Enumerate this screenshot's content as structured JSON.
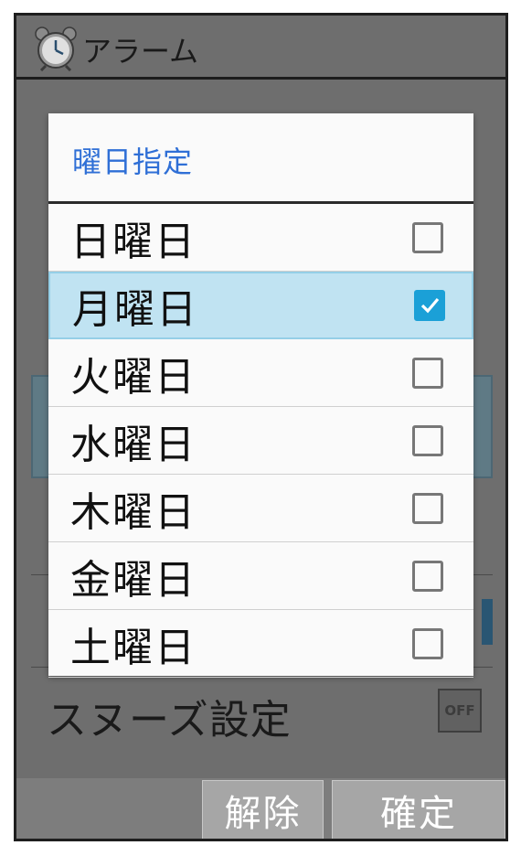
{
  "app": {
    "title": "アラーム",
    "icon": "alarm-clock-icon"
  },
  "background": {
    "snooze_label": "スヌーズ設定",
    "snooze_toggle": "OFF"
  },
  "dialog": {
    "title": "曜日指定",
    "days": [
      {
        "label": "日曜日",
        "checked": false
      },
      {
        "label": "月曜日",
        "checked": true
      },
      {
        "label": "火曜日",
        "checked": false
      },
      {
        "label": "水曜日",
        "checked": false
      },
      {
        "label": "木曜日",
        "checked": false
      },
      {
        "label": "金曜日",
        "checked": false
      },
      {
        "label": "土曜日",
        "checked": false
      }
    ]
  },
  "buttons": {
    "release": "解除",
    "confirm": "確定"
  },
  "colors": {
    "accent": "#1ba0d7",
    "title_blue": "#2f6fd6",
    "selected_row": "#c0e3f2",
    "overlay": "#6e6e6e"
  }
}
